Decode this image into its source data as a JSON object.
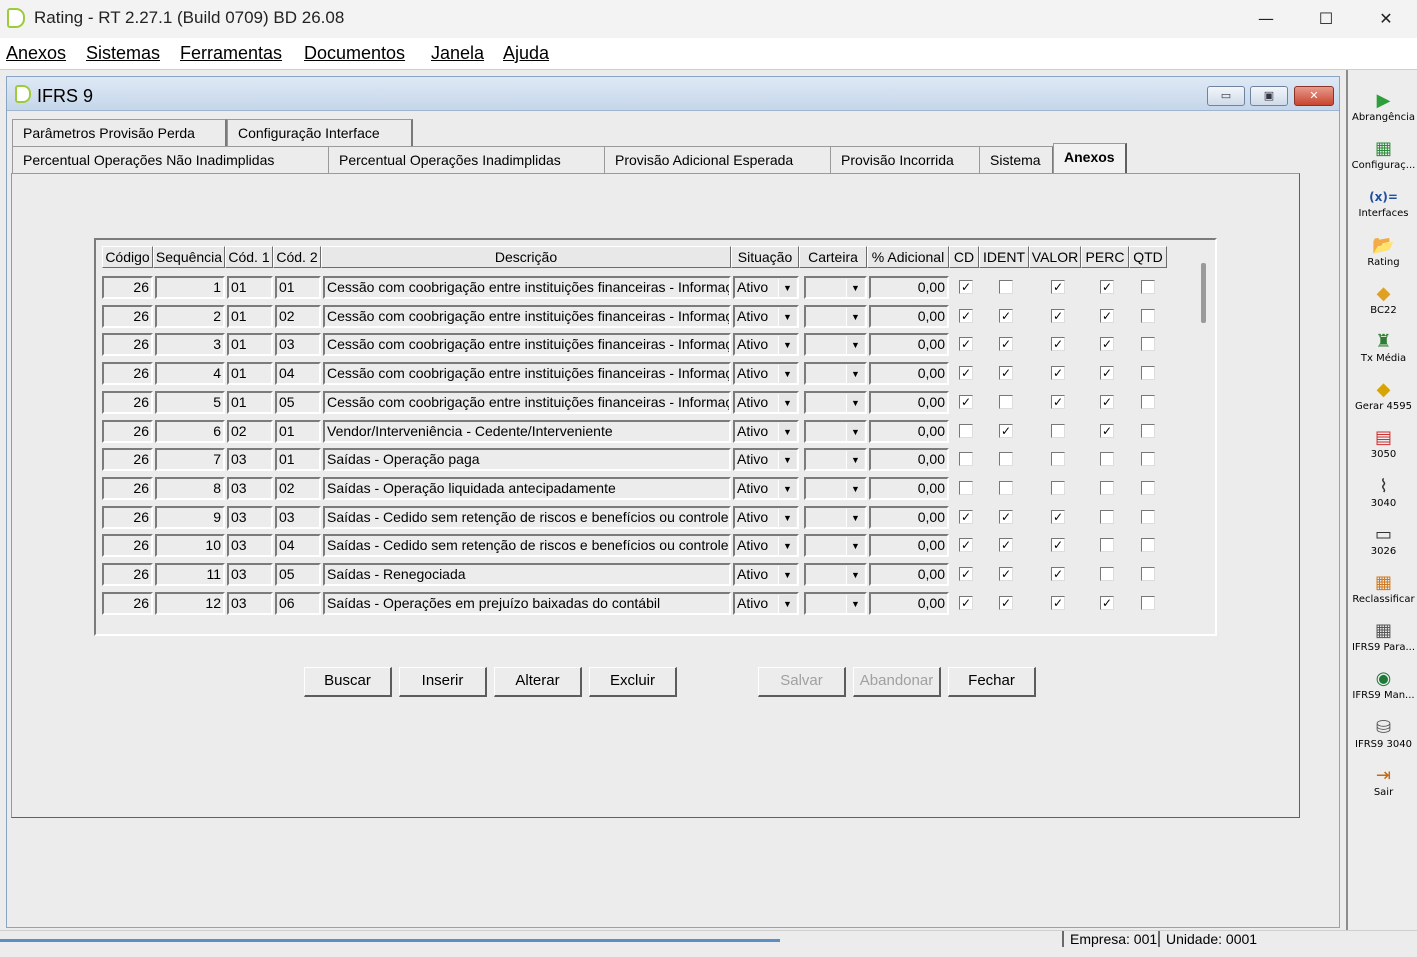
{
  "window": {
    "title": "Rating - RT 2.27.1 (Build 0709) BD 26.08",
    "minimize": "—",
    "maximize": "☐",
    "close": "✕"
  },
  "menu": [
    "Anexos",
    "Sistemas",
    "Ferramentas",
    "Documentos",
    "Janela",
    "Ajuda"
  ],
  "child_window": {
    "title": "IFRS 9",
    "min": "▭",
    "restore": "▣",
    "close": "✕"
  },
  "tabs_row1": [
    "Parâmetros Provisão Perda",
    "Configuração Interface"
  ],
  "tabs_row2": [
    "Percentual Operações Não Inadimplidas",
    "Percentual Operações Inadimplidas",
    "Provisão Adicional Esperada",
    "Provisão Incorrida",
    "Sistema",
    "Anexos"
  ],
  "active_tab": "Anexos",
  "grid": {
    "headers": [
      "Código",
      "Sequência",
      "Cód. 1",
      "Cód. 2",
      "Descrição",
      "Situação",
      "Carteira",
      "% Adicional",
      "CD",
      "IDENT",
      "VALOR",
      "PERC",
      "QTD"
    ],
    "rows": [
      {
        "codigo": "26",
        "seq": "1",
        "cod1": "01",
        "cod2": "01",
        "descricao": "Cessão com coobrigação entre instituições financeiras - Informaçõ",
        "situacao": "Ativo",
        "carteira": "",
        "adicional": "0,00",
        "cd": true,
        "ident": false,
        "valor": true,
        "perc": true,
        "qtd": false
      },
      {
        "codigo": "26",
        "seq": "2",
        "cod1": "01",
        "cod2": "02",
        "descricao": "Cessão com coobrigação entre instituições financeiras - Informaçõ",
        "situacao": "Ativo",
        "carteira": "",
        "adicional": "0,00",
        "cd": true,
        "ident": true,
        "valor": true,
        "perc": true,
        "qtd": false
      },
      {
        "codigo": "26",
        "seq": "3",
        "cod1": "01",
        "cod2": "03",
        "descricao": "Cessão com coobrigação entre instituições financeiras - Informaçõ",
        "situacao": "Ativo",
        "carteira": "",
        "adicional": "0,00",
        "cd": true,
        "ident": true,
        "valor": true,
        "perc": true,
        "qtd": false
      },
      {
        "codigo": "26",
        "seq": "4",
        "cod1": "01",
        "cod2": "04",
        "descricao": "Cessão com coobrigação entre instituições financeiras - Informaçõ",
        "situacao": "Ativo",
        "carteira": "",
        "adicional": "0,00",
        "cd": true,
        "ident": true,
        "valor": true,
        "perc": true,
        "qtd": false
      },
      {
        "codigo": "26",
        "seq": "5",
        "cod1": "01",
        "cod2": "05",
        "descricao": "Cessão com coobrigação entre instituições financeiras -  Informaç",
        "situacao": "Ativo",
        "carteira": "",
        "adicional": "0,00",
        "cd": true,
        "ident": false,
        "valor": true,
        "perc": true,
        "qtd": false
      },
      {
        "codigo": "26",
        "seq": "6",
        "cod1": "02",
        "cod2": "01",
        "descricao": "Vendor/Interveniência - Cedente/Interveniente",
        "situacao": "Ativo",
        "carteira": "",
        "adicional": "0,00",
        "cd": false,
        "ident": true,
        "valor": false,
        "perc": true,
        "qtd": false
      },
      {
        "codigo": "26",
        "seq": "7",
        "cod1": "03",
        "cod2": "01",
        "descricao": "Saídas - Operação paga",
        "situacao": "Ativo",
        "carteira": "",
        "adicional": "0,00",
        "cd": false,
        "ident": false,
        "valor": false,
        "perc": false,
        "qtd": false
      },
      {
        "codigo": "26",
        "seq": "8",
        "cod1": "03",
        "cod2": "02",
        "descricao": "Saídas - Operação liquidada antecipadamente",
        "situacao": "Ativo",
        "carteira": "",
        "adicional": "0,00",
        "cd": false,
        "ident": false,
        "valor": false,
        "perc": false,
        "qtd": false
      },
      {
        "codigo": "26",
        "seq": "9",
        "cod1": "03",
        "cod2": "03",
        "descricao": "Saídas - Cedido sem retenção de riscos e benefícios ou controle",
        "situacao": "Ativo",
        "carteira": "",
        "adicional": "0,00",
        "cd": true,
        "ident": true,
        "valor": true,
        "perc": false,
        "qtd": false
      },
      {
        "codigo": "26",
        "seq": "10",
        "cod1": "03",
        "cod2": "04",
        "descricao": "Saídas - Cedido sem retenção de riscos e benefícios ou controle",
        "situacao": "Ativo",
        "carteira": "",
        "adicional": "0,00",
        "cd": true,
        "ident": true,
        "valor": true,
        "perc": false,
        "qtd": false
      },
      {
        "codigo": "26",
        "seq": "11",
        "cod1": "03",
        "cod2": "05",
        "descricao": "Saídas - Renegociada",
        "situacao": "Ativo",
        "carteira": "",
        "adicional": "0,00",
        "cd": true,
        "ident": true,
        "valor": true,
        "perc": false,
        "qtd": false
      },
      {
        "codigo": "26",
        "seq": "12",
        "cod1": "03",
        "cod2": "06",
        "descricao": "Saídas - Operações em prejuízo baixadas do contábil",
        "situacao": "Ativo",
        "carteira": "",
        "adicional": "0,00",
        "cd": true,
        "ident": true,
        "valor": true,
        "perc": true,
        "qtd": false
      }
    ]
  },
  "buttons": [
    {
      "label": "Buscar",
      "enabled": true
    },
    {
      "label": "Inserir",
      "enabled": true
    },
    {
      "label": "Alterar",
      "enabled": true
    },
    {
      "label": "Excluir",
      "enabled": true
    },
    {
      "label": "Salvar",
      "enabled": false
    },
    {
      "label": "Abandonar",
      "enabled": false
    },
    {
      "label": "Fechar",
      "enabled": true
    }
  ],
  "toolbar": [
    {
      "label": "Abrangência",
      "icon": "play-arrow-icon",
      "glyph": "▶",
      "color": "#2e9e3a"
    },
    {
      "label": "Configuraç...",
      "icon": "grid-config-icon",
      "glyph": "▦",
      "color": "#2e8b3a"
    },
    {
      "label": "Interfaces",
      "icon": "function-icon",
      "glyph": "(x)=",
      "color": "#1f4fa0"
    },
    {
      "label": "Rating",
      "icon": "folder-icon",
      "glyph": "📂",
      "color": "#3b79c8"
    },
    {
      "label": "BC22",
      "icon": "cube-icon",
      "glyph": "◆",
      "color": "#e0a020"
    },
    {
      "label": "Tx Média",
      "icon": "building-icon",
      "glyph": "♜",
      "color": "#2e7d32"
    },
    {
      "label": "Gerar 4595",
      "icon": "diamond-arrow-icon",
      "glyph": "◆",
      "color": "#d9a300"
    },
    {
      "label": "3050",
      "icon": "database-stack-icon",
      "glyph": "▤",
      "color": "#d03030"
    },
    {
      "label": "3040",
      "icon": "chart-line-icon",
      "glyph": "⌇",
      "color": "#333333"
    },
    {
      "label": "3026",
      "icon": "monitor-icon",
      "glyph": "▭",
      "color": "#333333"
    },
    {
      "label": "Reclassificar",
      "icon": "grid-orange-icon",
      "glyph": "▦",
      "color": "#d0781e"
    },
    {
      "label": "IFRS9 Para...",
      "icon": "table-icon",
      "glyph": "▦",
      "color": "#555555"
    },
    {
      "label": "IFRS9 Man...",
      "icon": "chart-circle-icon",
      "glyph": "◉",
      "color": "#1f7a3a"
    },
    {
      "label": "IFRS9 3040",
      "icon": "database-icon",
      "glyph": "⛁",
      "color": "#555555"
    },
    {
      "label": "Sair",
      "icon": "exit-door-icon",
      "glyph": "⇥",
      "color": "#c46a10"
    }
  ],
  "status": {
    "empresa": "Empresa: 001",
    "unidade": "Unidade: 0001"
  }
}
